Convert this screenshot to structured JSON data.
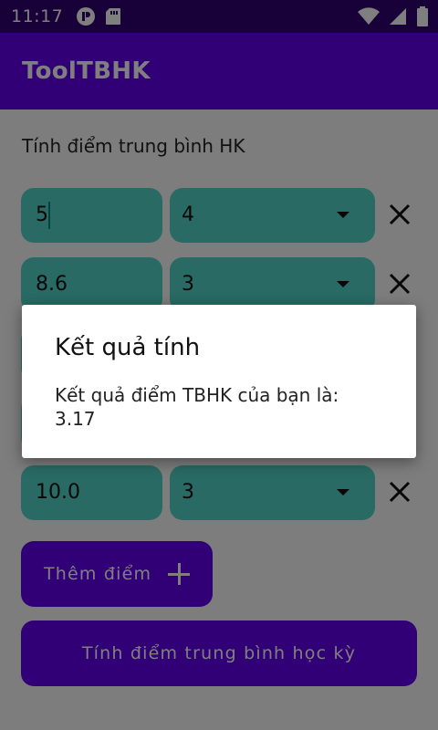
{
  "status_bar": {
    "time": "11:17"
  },
  "app_bar": {
    "title": "ToolTBHK"
  },
  "form": {
    "subtitle": "Tính điểm trung bình HK",
    "rows": [
      {
        "score": "5",
        "credit": "4"
      },
      {
        "score": "8.6",
        "credit": "3"
      },
      {
        "score": "10.0",
        "credit": "3"
      }
    ]
  },
  "buttons": {
    "add_label": "Thêm điểm",
    "calculate_label": "Tính điểm trung bình học kỳ"
  },
  "dialog": {
    "title": "Kết quả tính",
    "message": "Kết quả điểm TBHK của bạn là: 3.17"
  },
  "colors": {
    "primary": "#6200ee",
    "primary_dark": "#300070",
    "field": "#52d5c8"
  }
}
